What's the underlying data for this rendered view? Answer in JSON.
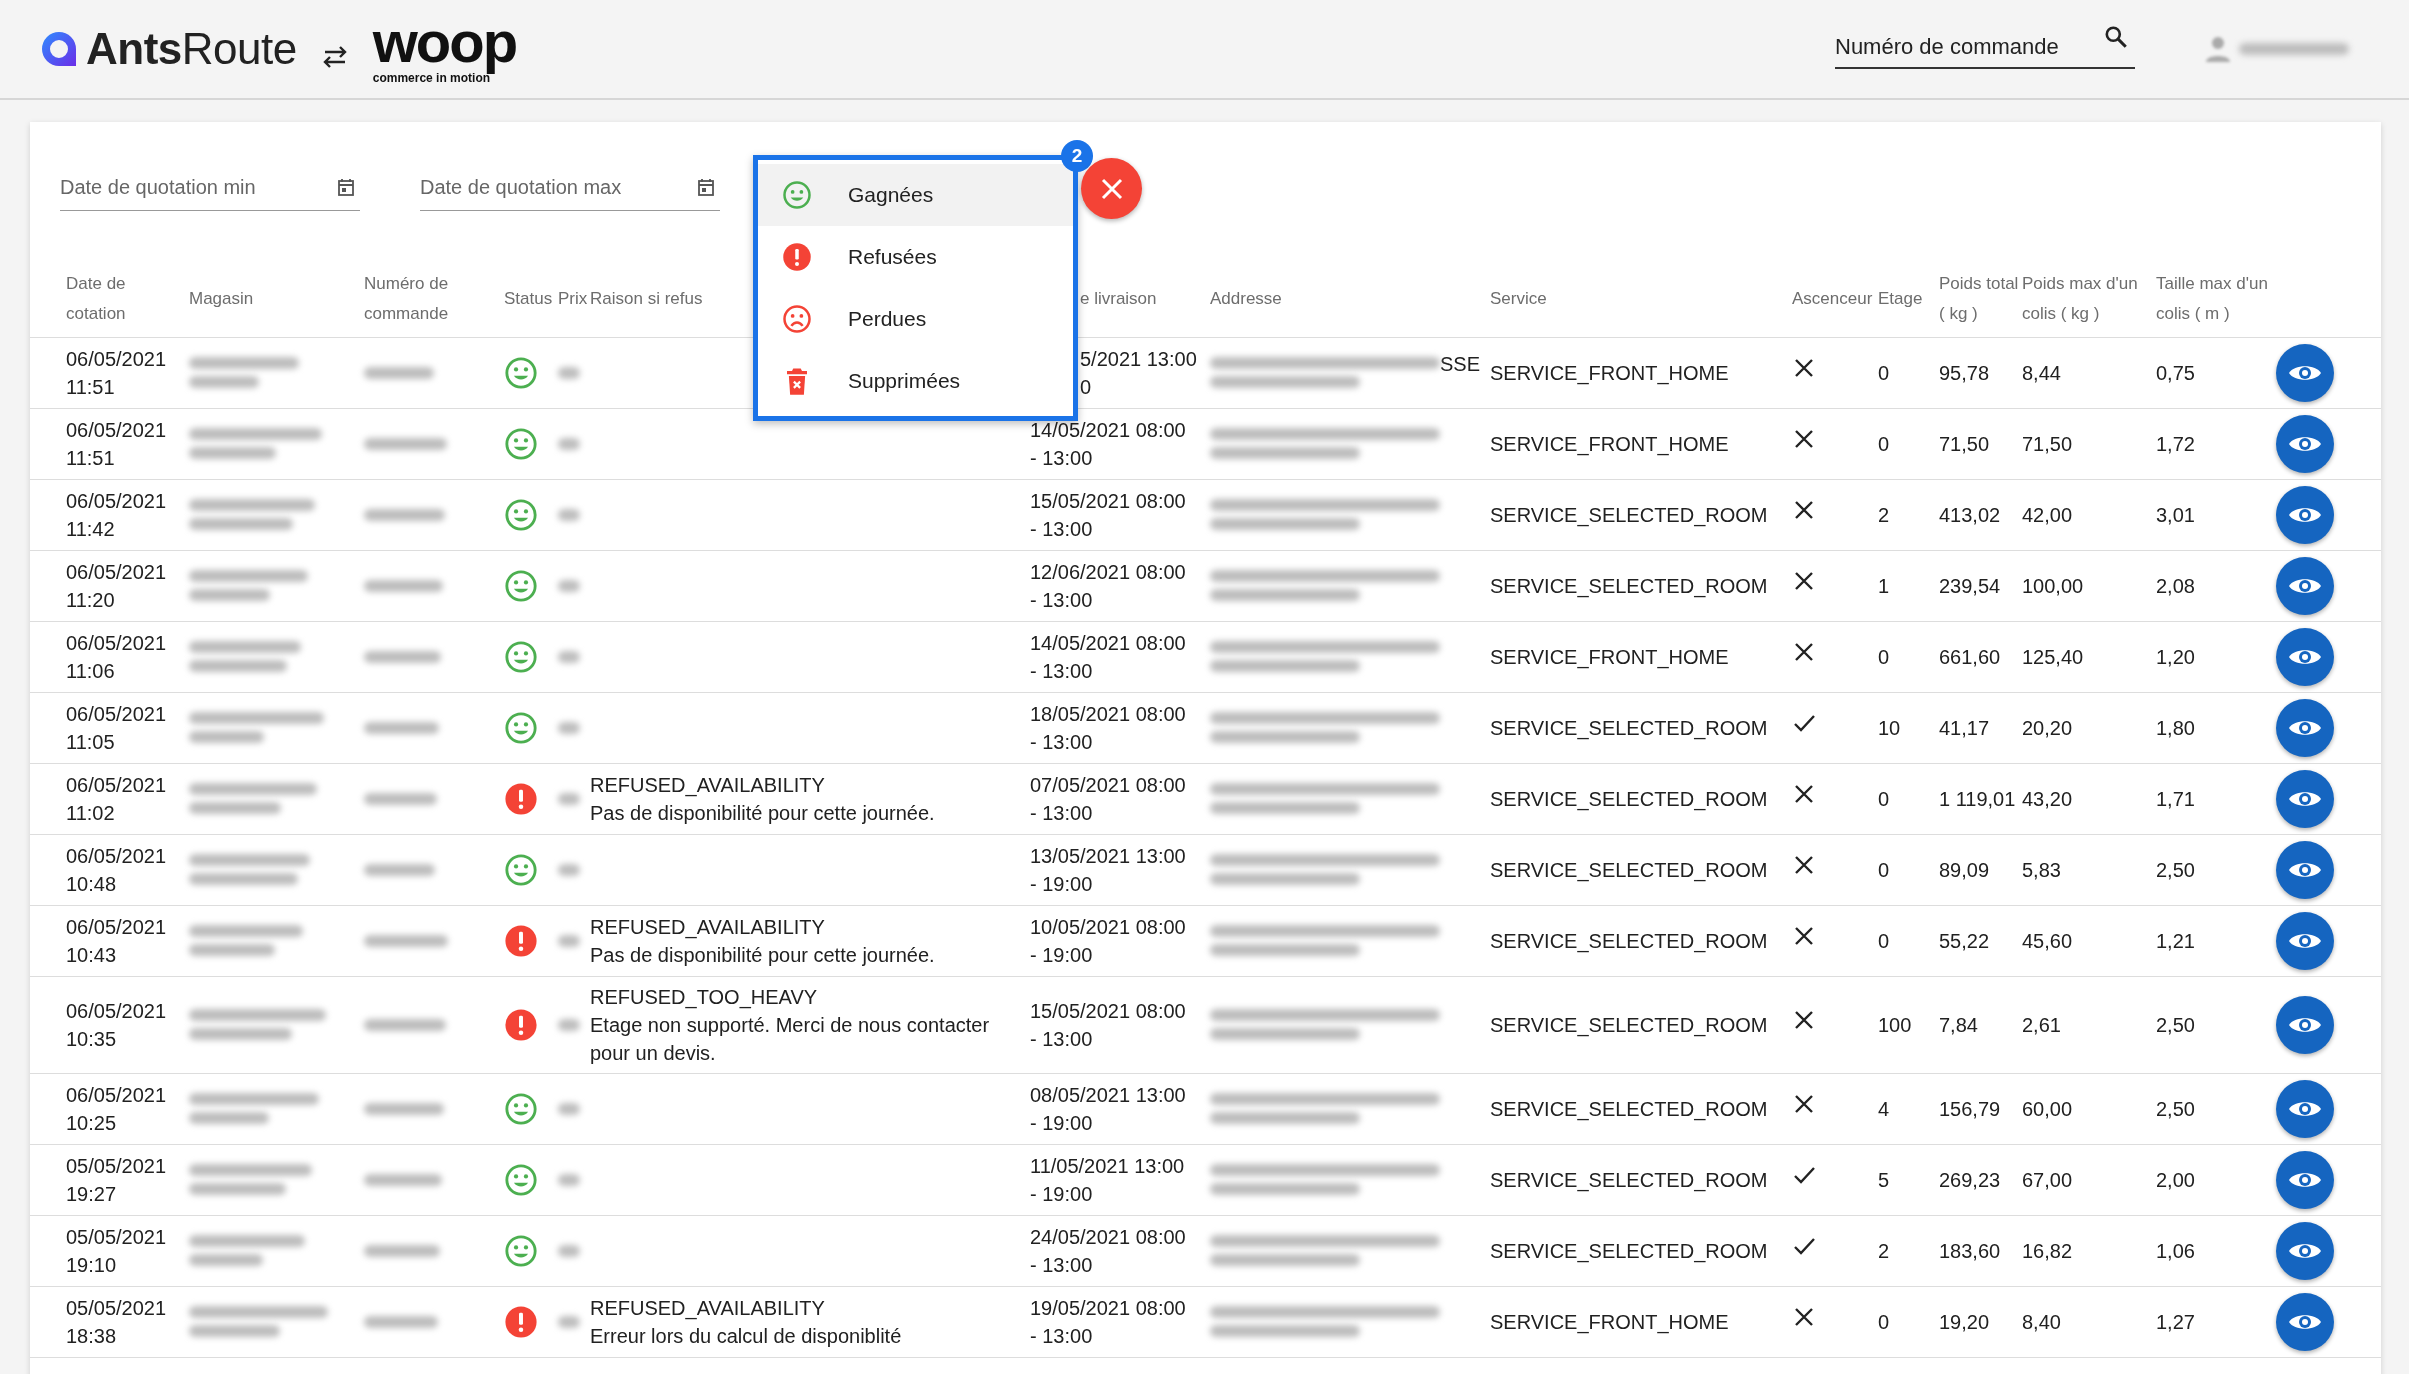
{
  "header": {
    "logo": "**Ants**Route",
    "partner_logo": "woop",
    "partner_tagline": "commerce in motion",
    "search": {
      "placeholder": "Numéro de commande"
    }
  },
  "filters": {
    "date_min": {
      "placeholder": "Date de quotation min"
    },
    "date_max": {
      "placeholder": "Date de quotation max"
    }
  },
  "status_menu": {
    "badge": "2",
    "items": [
      {
        "kind": "won",
        "label": "Gagnées",
        "selected": true
      },
      {
        "kind": "refused",
        "label": "Refusées",
        "selected": false
      },
      {
        "kind": "lost",
        "label": "Perdues",
        "selected": false
      },
      {
        "kind": "deleted",
        "label": "Supprimées",
        "selected": false
      }
    ]
  },
  "table": {
    "columns": [
      {
        "label": "Date de cotation"
      },
      {
        "label": "Magasin"
      },
      {
        "label": "Numéro de commande"
      },
      {
        "label": "Status"
      },
      {
        "label": "Prix"
      },
      {
        "label": "Raison si refus"
      },
      {
        "label": "e livraison",
        "occluded": true
      },
      {
        "label": "Addresse"
      },
      {
        "label": "Service"
      },
      {
        "label": "Ascenceur"
      },
      {
        "label": "Etage"
      },
      {
        "label": "Poids total ( kg )"
      },
      {
        "label": "Poids max d'un colis ( kg )"
      },
      {
        "label": "Taille max d'un colis ( m )"
      }
    ],
    "rows": [
      {
        "date": "06/05/2021",
        "time": "11:51",
        "kind": "won",
        "delivery": "5/2021 13:00",
        "delivery_window": "0",
        "delivery_occluded": true,
        "address_tail": "SSE",
        "service": "SERVICE_FRONT_HOME",
        "elevator": false,
        "floor": "0",
        "weight": "95,78",
        "max_weight": "8,44",
        "max_size": "0,75"
      },
      {
        "date": "06/05/2021",
        "time": "11:51",
        "kind": "won",
        "delivery": "14/05/2021 08:00",
        "delivery_window": "- 13:00",
        "service": "SERVICE_FRONT_HOME",
        "elevator": false,
        "floor": "0",
        "weight": "71,50",
        "max_weight": "71,50",
        "max_size": "1,72"
      },
      {
        "date": "06/05/2021",
        "time": "11:42",
        "kind": "won",
        "delivery": "15/05/2021 08:00",
        "delivery_window": "- 13:00",
        "service": "SERVICE_SELECTED_ROOM",
        "elevator": false,
        "floor": "2",
        "weight": "413,02",
        "max_weight": "42,00",
        "max_size": "3,01"
      },
      {
        "date": "06/05/2021",
        "time": "11:20",
        "kind": "won",
        "delivery": "12/06/2021 08:00",
        "delivery_window": "- 13:00",
        "service": "SERVICE_SELECTED_ROOM",
        "elevator": false,
        "floor": "1",
        "weight": "239,54",
        "max_weight": "100,00",
        "max_size": "2,08"
      },
      {
        "date": "06/05/2021",
        "time": "11:06",
        "kind": "won",
        "delivery": "14/05/2021 08:00",
        "delivery_window": "- 13:00",
        "service": "SERVICE_FRONT_HOME",
        "elevator": false,
        "floor": "0",
        "weight": "661,60",
        "max_weight": "125,40",
        "max_size": "1,20"
      },
      {
        "date": "06/05/2021",
        "time": "11:05",
        "kind": "won",
        "delivery": "18/05/2021 08:00",
        "delivery_window": "- 13:00",
        "service": "SERVICE_SELECTED_ROOM",
        "elevator": true,
        "floor": "10",
        "weight": "41,17",
        "max_weight": "20,20",
        "max_size": "1,80"
      },
      {
        "date": "06/05/2021",
        "time": "11:02",
        "kind": "refused",
        "reason_code": "REFUSED_AVAILABILITY",
        "reason": "Pas de disponibilité pour cette journée.",
        "delivery": "07/05/2021 08:00",
        "delivery_window": "- 13:00",
        "service": "SERVICE_SELECTED_ROOM",
        "elevator": false,
        "floor": "0",
        "weight": "1 119,01",
        "max_weight": "43,20",
        "max_size": "1,71"
      },
      {
        "date": "06/05/2021",
        "time": "10:48",
        "kind": "won",
        "delivery": "13/05/2021 13:00",
        "delivery_window": "- 19:00",
        "service": "SERVICE_SELECTED_ROOM",
        "elevator": false,
        "floor": "0",
        "weight": "89,09",
        "max_weight": "5,83",
        "max_size": "2,50"
      },
      {
        "date": "06/05/2021",
        "time": "10:43",
        "kind": "refused",
        "reason_code": "REFUSED_AVAILABILITY",
        "reason": "Pas de disponibilité pour cette journée.",
        "delivery": "10/05/2021 08:00",
        "delivery_window": "- 19:00",
        "service": "SERVICE_SELECTED_ROOM",
        "elevator": false,
        "floor": "0",
        "weight": "55,22",
        "max_weight": "45,60",
        "max_size": "1,21"
      },
      {
        "date": "06/05/2021",
        "time": "10:35",
        "kind": "refused",
        "reason_code": "REFUSED_TOO_HEAVY",
        "reason": "Etage non supporté. Merci de nous contacter pour un devis.",
        "delivery": "15/05/2021 08:00",
        "delivery_window": "- 13:00",
        "service": "SERVICE_SELECTED_ROOM",
        "elevator": false,
        "floor": "100",
        "weight": "7,84",
        "max_weight": "2,61",
        "max_size": "2,50"
      },
      {
        "date": "06/05/2021",
        "time": "10:25",
        "kind": "won",
        "delivery": "08/05/2021 13:00",
        "delivery_window": "- 19:00",
        "service": "SERVICE_SELECTED_ROOM",
        "elevator": false,
        "floor": "4",
        "weight": "156,79",
        "max_weight": "60,00",
        "max_size": "2,50"
      },
      {
        "date": "05/05/2021",
        "time": "19:27",
        "kind": "won",
        "delivery": "11/05/2021 13:00",
        "delivery_window": "- 19:00",
        "service": "SERVICE_SELECTED_ROOM",
        "elevator": true,
        "floor": "5",
        "weight": "269,23",
        "max_weight": "67,00",
        "max_size": "2,00"
      },
      {
        "date": "05/05/2021",
        "time": "19:10",
        "kind": "won",
        "delivery": "24/05/2021 08:00",
        "delivery_window": "- 13:00",
        "service": "SERVICE_SELECTED_ROOM",
        "elevator": true,
        "floor": "2",
        "weight": "183,60",
        "max_weight": "16,82",
        "max_size": "1,06"
      },
      {
        "date": "05/05/2021",
        "time": "18:38",
        "kind": "refused",
        "reason_code": "REFUSED_AVAILABILITY",
        "reason": "Erreur lors du calcul de disponiblité",
        "delivery": "19/05/2021 08:00",
        "delivery_window": "- 13:00",
        "service": "SERVICE_FRONT_HOME",
        "elevator": false,
        "floor": "0",
        "weight": "19,20",
        "max_weight": "8,40",
        "max_size": "1,27"
      }
    ]
  }
}
